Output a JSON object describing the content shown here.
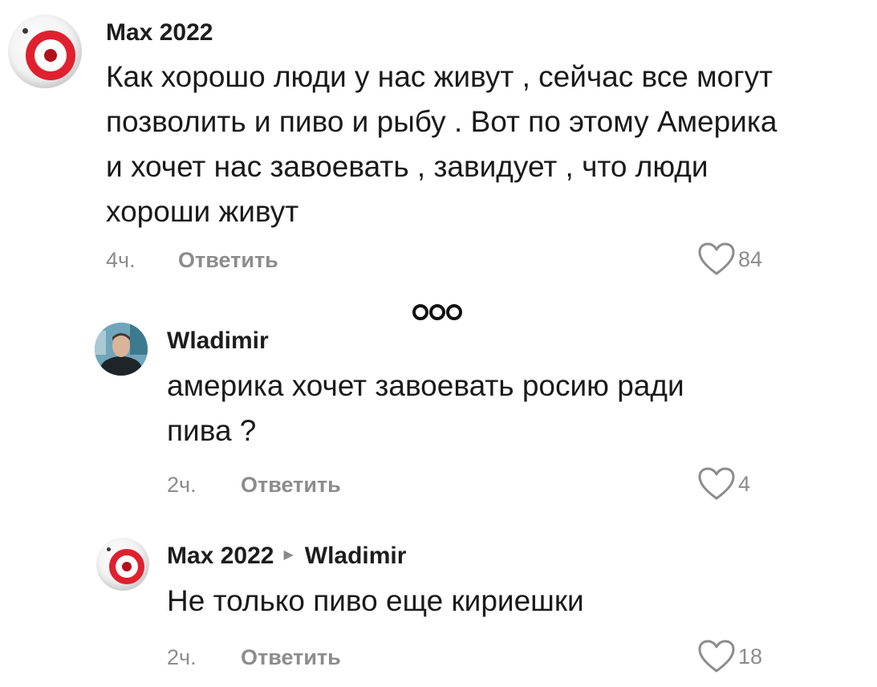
{
  "comments": [
    {
      "author": "Max 2022",
      "text_lines": [
        "Как хорошо люди у нас живут , сейчас все могут",
        "позволить и пиво и рыбу . Вот по этому Америка",
        "и хочет нас завоевать , завидует , что люди",
        "хороши живут"
      ],
      "time": "4ч.",
      "reply_label": "Ответить",
      "likes": "84",
      "avatar_icon": "red-eye-avatar"
    },
    {
      "author": "Wladimir",
      "text_lines": [
        "америка хочет завоевать росию ради",
        "пива ?"
      ],
      "time": "2ч.",
      "reply_label": "Ответить",
      "likes": "4",
      "avatar_icon": "user-photo-avatar"
    },
    {
      "author": "Max 2022",
      "reply_to": "Wladimir",
      "text_lines": [
        "Не только пиво еще кириешки"
      ],
      "time": "2ч.",
      "reply_label": "Ответить",
      "likes": "18",
      "avatar_icon": "red-eye-avatar"
    }
  ],
  "icons": {
    "like": "heart-outline-icon",
    "more": "three-circles-icon",
    "reply_arrow": "triangle-right-icon"
  },
  "colors": {
    "text": "#1a1a1a",
    "muted": "#8c8c8c",
    "accent_red": "#e0202e"
  }
}
